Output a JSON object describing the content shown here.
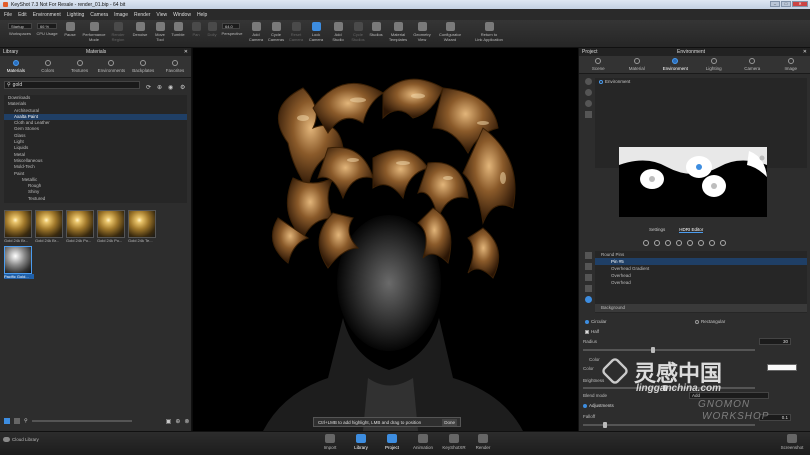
{
  "window": {
    "title": "KeyShot 7.3 Not For Resale - render_01.bip - 64 bit"
  },
  "menu": [
    "File",
    "Edit",
    "Environment",
    "Lighting",
    "Camera",
    "Image",
    "Render",
    "View",
    "Window",
    "Help"
  ],
  "toolbar": {
    "workspace_value": "Startup",
    "cpu_value": "66 %",
    "zoom_value": "64.0",
    "buttons": [
      "Workspaces",
      "CPU Usage",
      "Pause",
      "Performance\nMode",
      "Render\nRegion",
      "Denoise",
      "Region",
      "Move\nTool",
      "Tumble",
      "Pan",
      "Dolly",
      "Perspective",
      "Add\nCamera",
      "Cycle\nCameras",
      "Reset\nCamera",
      "Lock\nCamera",
      "Add\nStudio",
      "Cycle\nStudios",
      "Studios",
      "Material\nTemplates",
      "Geometry\nView",
      "Configurator\nWizard",
      "Return to\nLink Application"
    ]
  },
  "library": {
    "panel_title": "Library",
    "header": "Materials",
    "tabs": [
      "Materials",
      "Colors",
      "Textures",
      "Environments",
      "Backplates",
      "Favorites"
    ],
    "search_value": "gold",
    "tree": [
      {
        "label": "Downloads",
        "depth": 0
      },
      {
        "label": "Materials",
        "depth": 0
      },
      {
        "label": "Architectural",
        "depth": 1
      },
      {
        "label": "Axalta Paint",
        "depth": 1,
        "selected": true
      },
      {
        "label": "Cloth and Leather",
        "depth": 1
      },
      {
        "label": "Gem Stones",
        "depth": 1
      },
      {
        "label": "Glass",
        "depth": 1
      },
      {
        "label": "Light",
        "depth": 1
      },
      {
        "label": "Liquids",
        "depth": 1
      },
      {
        "label": "Metal",
        "depth": 1
      },
      {
        "label": "Miscellaneous",
        "depth": 1
      },
      {
        "label": "Mold-Tech",
        "depth": 1
      },
      {
        "label": "Paint",
        "depth": 1
      },
      {
        "label": "Metallic",
        "depth": 2
      },
      {
        "label": "Rough",
        "depth": 3
      },
      {
        "label": "Shiny",
        "depth": 3
      },
      {
        "label": "Textured",
        "depth": 3
      }
    ],
    "thumbnails": [
      {
        "label": "Gold 24k Br..."
      },
      {
        "label": "Gold 24k Br..."
      },
      {
        "label": "Gold 24k Po..."
      },
      {
        "label": "Gold 24k Po..."
      },
      {
        "label": "Gold 24k Te..."
      },
      {
        "label": "Pacific Gold...",
        "selected": true
      }
    ],
    "footer_label": "Cloud Library"
  },
  "viewport": {
    "hint": "Ctrl+LMB to add highlight, LMB and drag to position",
    "hint_button": "Done"
  },
  "project": {
    "panel_title": "Project",
    "header": "Environment",
    "tabs": [
      "Scene",
      "Material",
      "Environment",
      "Lighting",
      "Camera",
      "Image"
    ],
    "env_item": "Environment",
    "subtabs": [
      "Settings",
      "HDRI Editor"
    ],
    "pins": [
      {
        "label": "Round Pins",
        "depth": 0
      },
      {
        "label": "Pin #5",
        "depth": 1,
        "selected": true
      },
      {
        "label": "Overhead Gradient",
        "depth": 1
      },
      {
        "label": "Overhead",
        "depth": 1
      },
      {
        "label": "Overhead",
        "depth": 1
      }
    ],
    "background_label": "Background",
    "shape_options": [
      "Circular",
      "Rectangular"
    ],
    "half_label": "Half",
    "radius_label": "Radius",
    "radius_value": "30",
    "color_label": "Color",
    "brightness_label": "Brightness",
    "blend_label": "Blend mode",
    "blend_value": "Add",
    "adjustments_label": "Adjustments",
    "falloff_label": "Falloff",
    "falloff_value": "0.1"
  },
  "bottom": {
    "buttons": [
      "Import",
      "Library",
      "Project",
      "Animation",
      "KeyShotXR",
      "Render"
    ],
    "active": "Project",
    "screenshot_label": "Screenshot"
  },
  "watermark": {
    "chinese": "灵感中国",
    "url": "lingganchina.com",
    "brand_line1": "GNOMON",
    "brand_line2": "WORKSHOP"
  },
  "colors": {
    "accent": "#3d8de0",
    "selection": "#1f5fa8",
    "gold": "#b8883a"
  }
}
